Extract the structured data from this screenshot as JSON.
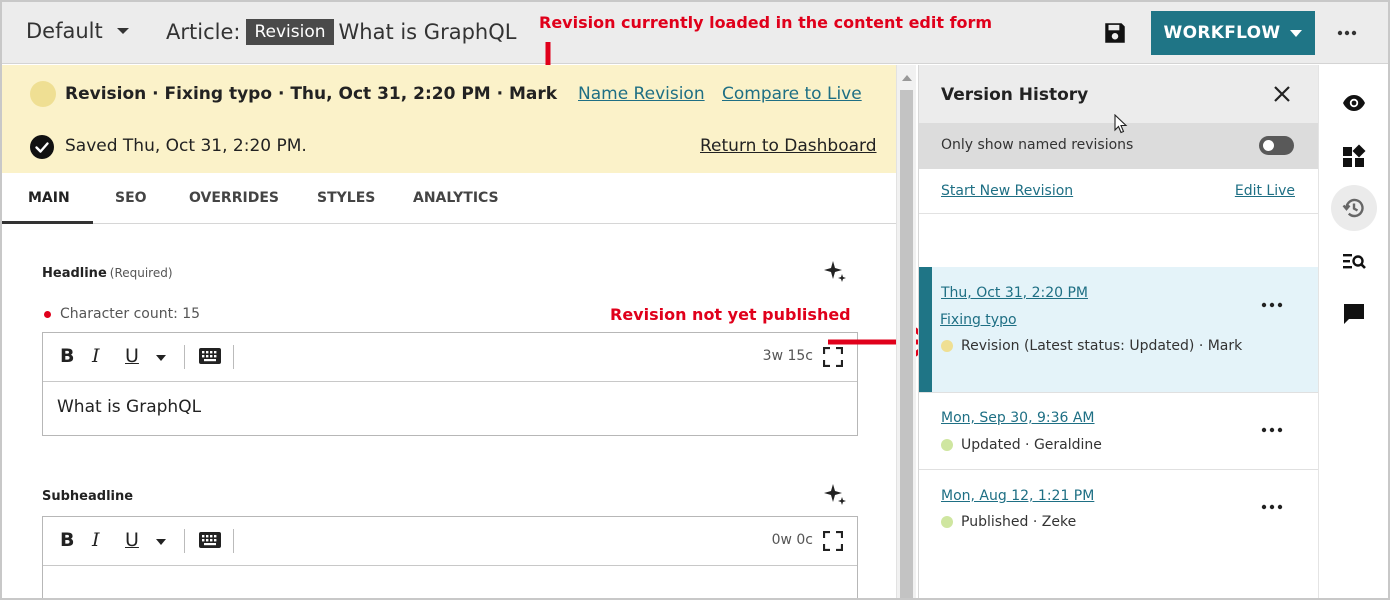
{
  "topbar": {
    "site_selector": "Default",
    "article_prefix": "Article:",
    "revision_badge": "Revision",
    "article_title": "What is GraphQL",
    "workflow_label": "WORKFLOW"
  },
  "annotations": {
    "top": "Revision currently loaded in the content edit form",
    "middle": "Revision not yet published",
    "color": "#e0001b"
  },
  "banner": {
    "revision_line": "Revision · Fixing typo · Thu, Oct 31, 2:20 PM · Mark",
    "name_revision": "Name Revision",
    "compare_to_live": "Compare to Live",
    "saved_text": "Saved Thu, Oct 31, 2:20 PM.",
    "return_to_dashboard": "Return to Dashboard",
    "background_color": "#fbf2c9"
  },
  "tabs": [
    {
      "label": "MAIN",
      "active": true
    },
    {
      "label": "SEO",
      "active": false
    },
    {
      "label": "OVERRIDES",
      "active": false
    },
    {
      "label": "STYLES",
      "active": false
    },
    {
      "label": "ANALYTICS",
      "active": false
    }
  ],
  "form": {
    "headline": {
      "label": "Headline",
      "required_text": "(Required)",
      "char_count": "Character count: 15",
      "word_char": "3w 15c",
      "value": "What is GraphQL"
    },
    "subheadline": {
      "label": "Subheadline",
      "word_char": "0w 0c",
      "value": ""
    },
    "toolbar": {
      "bold": "B",
      "italic": "I",
      "underline": "U"
    }
  },
  "version_history": {
    "title": "Version History",
    "filter_label": "Only show named revisions",
    "filter_on": false,
    "start_new_revision": "Start New Revision",
    "edit_live": "Edit Live",
    "items": [
      {
        "date": "Thu, Oct 31, 2:20 PM",
        "name": "Fixing typo",
        "status": "Revision (Latest status: Updated) · Mark",
        "status_color": "#efdf93",
        "selected": true
      },
      {
        "date": "Mon, Sep 30, 9:36 AM",
        "name": "",
        "status": "Updated · Geraldine",
        "status_color": "#cfe6a0",
        "selected": false
      },
      {
        "date": "Mon, Aug 12, 1:21 PM",
        "name": "",
        "status": "Published · Zeke",
        "status_color": "#cfe6a0",
        "selected": false
      }
    ]
  },
  "rail": [
    {
      "icon": "eye-icon"
    },
    {
      "icon": "widgets-icon"
    },
    {
      "icon": "history-icon",
      "active": true
    },
    {
      "icon": "search-list-icon"
    },
    {
      "icon": "comment-icon"
    }
  ],
  "colors": {
    "accent": "#1f7586",
    "selected_row": "#e4f3f9"
  }
}
